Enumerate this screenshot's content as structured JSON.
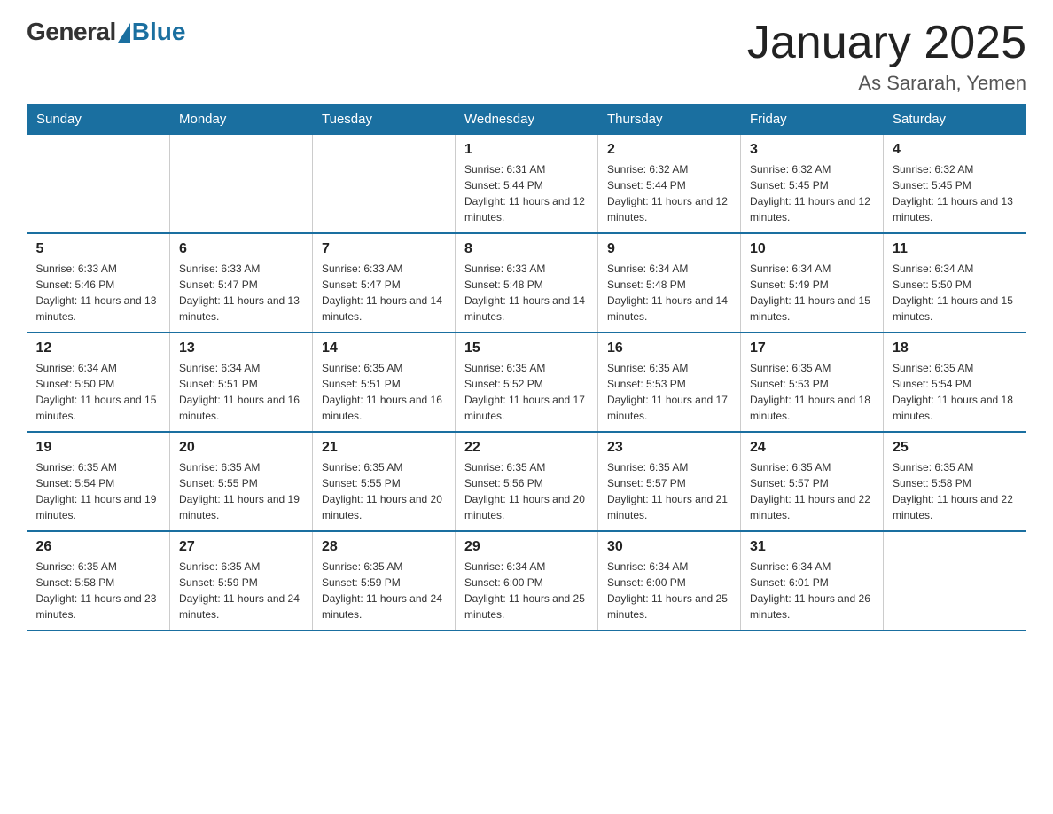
{
  "logo": {
    "general": "General",
    "blue": "Blue"
  },
  "header": {
    "title": "January 2025",
    "location": "As Sararah, Yemen"
  },
  "days_of_week": [
    "Sunday",
    "Monday",
    "Tuesday",
    "Wednesday",
    "Thursday",
    "Friday",
    "Saturday"
  ],
  "weeks": [
    [
      {
        "day": "",
        "info": ""
      },
      {
        "day": "",
        "info": ""
      },
      {
        "day": "",
        "info": ""
      },
      {
        "day": "1",
        "info": "Sunrise: 6:31 AM\nSunset: 5:44 PM\nDaylight: 11 hours and 12 minutes."
      },
      {
        "day": "2",
        "info": "Sunrise: 6:32 AM\nSunset: 5:44 PM\nDaylight: 11 hours and 12 minutes."
      },
      {
        "day": "3",
        "info": "Sunrise: 6:32 AM\nSunset: 5:45 PM\nDaylight: 11 hours and 12 minutes."
      },
      {
        "day": "4",
        "info": "Sunrise: 6:32 AM\nSunset: 5:45 PM\nDaylight: 11 hours and 13 minutes."
      }
    ],
    [
      {
        "day": "5",
        "info": "Sunrise: 6:33 AM\nSunset: 5:46 PM\nDaylight: 11 hours and 13 minutes."
      },
      {
        "day": "6",
        "info": "Sunrise: 6:33 AM\nSunset: 5:47 PM\nDaylight: 11 hours and 13 minutes."
      },
      {
        "day": "7",
        "info": "Sunrise: 6:33 AM\nSunset: 5:47 PM\nDaylight: 11 hours and 14 minutes."
      },
      {
        "day": "8",
        "info": "Sunrise: 6:33 AM\nSunset: 5:48 PM\nDaylight: 11 hours and 14 minutes."
      },
      {
        "day": "9",
        "info": "Sunrise: 6:34 AM\nSunset: 5:48 PM\nDaylight: 11 hours and 14 minutes."
      },
      {
        "day": "10",
        "info": "Sunrise: 6:34 AM\nSunset: 5:49 PM\nDaylight: 11 hours and 15 minutes."
      },
      {
        "day": "11",
        "info": "Sunrise: 6:34 AM\nSunset: 5:50 PM\nDaylight: 11 hours and 15 minutes."
      }
    ],
    [
      {
        "day": "12",
        "info": "Sunrise: 6:34 AM\nSunset: 5:50 PM\nDaylight: 11 hours and 15 minutes."
      },
      {
        "day": "13",
        "info": "Sunrise: 6:34 AM\nSunset: 5:51 PM\nDaylight: 11 hours and 16 minutes."
      },
      {
        "day": "14",
        "info": "Sunrise: 6:35 AM\nSunset: 5:51 PM\nDaylight: 11 hours and 16 minutes."
      },
      {
        "day": "15",
        "info": "Sunrise: 6:35 AM\nSunset: 5:52 PM\nDaylight: 11 hours and 17 minutes."
      },
      {
        "day": "16",
        "info": "Sunrise: 6:35 AM\nSunset: 5:53 PM\nDaylight: 11 hours and 17 minutes."
      },
      {
        "day": "17",
        "info": "Sunrise: 6:35 AM\nSunset: 5:53 PM\nDaylight: 11 hours and 18 minutes."
      },
      {
        "day": "18",
        "info": "Sunrise: 6:35 AM\nSunset: 5:54 PM\nDaylight: 11 hours and 18 minutes."
      }
    ],
    [
      {
        "day": "19",
        "info": "Sunrise: 6:35 AM\nSunset: 5:54 PM\nDaylight: 11 hours and 19 minutes."
      },
      {
        "day": "20",
        "info": "Sunrise: 6:35 AM\nSunset: 5:55 PM\nDaylight: 11 hours and 19 minutes."
      },
      {
        "day": "21",
        "info": "Sunrise: 6:35 AM\nSunset: 5:55 PM\nDaylight: 11 hours and 20 minutes."
      },
      {
        "day": "22",
        "info": "Sunrise: 6:35 AM\nSunset: 5:56 PM\nDaylight: 11 hours and 20 minutes."
      },
      {
        "day": "23",
        "info": "Sunrise: 6:35 AM\nSunset: 5:57 PM\nDaylight: 11 hours and 21 minutes."
      },
      {
        "day": "24",
        "info": "Sunrise: 6:35 AM\nSunset: 5:57 PM\nDaylight: 11 hours and 22 minutes."
      },
      {
        "day": "25",
        "info": "Sunrise: 6:35 AM\nSunset: 5:58 PM\nDaylight: 11 hours and 22 minutes."
      }
    ],
    [
      {
        "day": "26",
        "info": "Sunrise: 6:35 AM\nSunset: 5:58 PM\nDaylight: 11 hours and 23 minutes."
      },
      {
        "day": "27",
        "info": "Sunrise: 6:35 AM\nSunset: 5:59 PM\nDaylight: 11 hours and 24 minutes."
      },
      {
        "day": "28",
        "info": "Sunrise: 6:35 AM\nSunset: 5:59 PM\nDaylight: 11 hours and 24 minutes."
      },
      {
        "day": "29",
        "info": "Sunrise: 6:34 AM\nSunset: 6:00 PM\nDaylight: 11 hours and 25 minutes."
      },
      {
        "day": "30",
        "info": "Sunrise: 6:34 AM\nSunset: 6:00 PM\nDaylight: 11 hours and 25 minutes."
      },
      {
        "day": "31",
        "info": "Sunrise: 6:34 AM\nSunset: 6:01 PM\nDaylight: 11 hours and 26 minutes."
      },
      {
        "day": "",
        "info": ""
      }
    ]
  ]
}
